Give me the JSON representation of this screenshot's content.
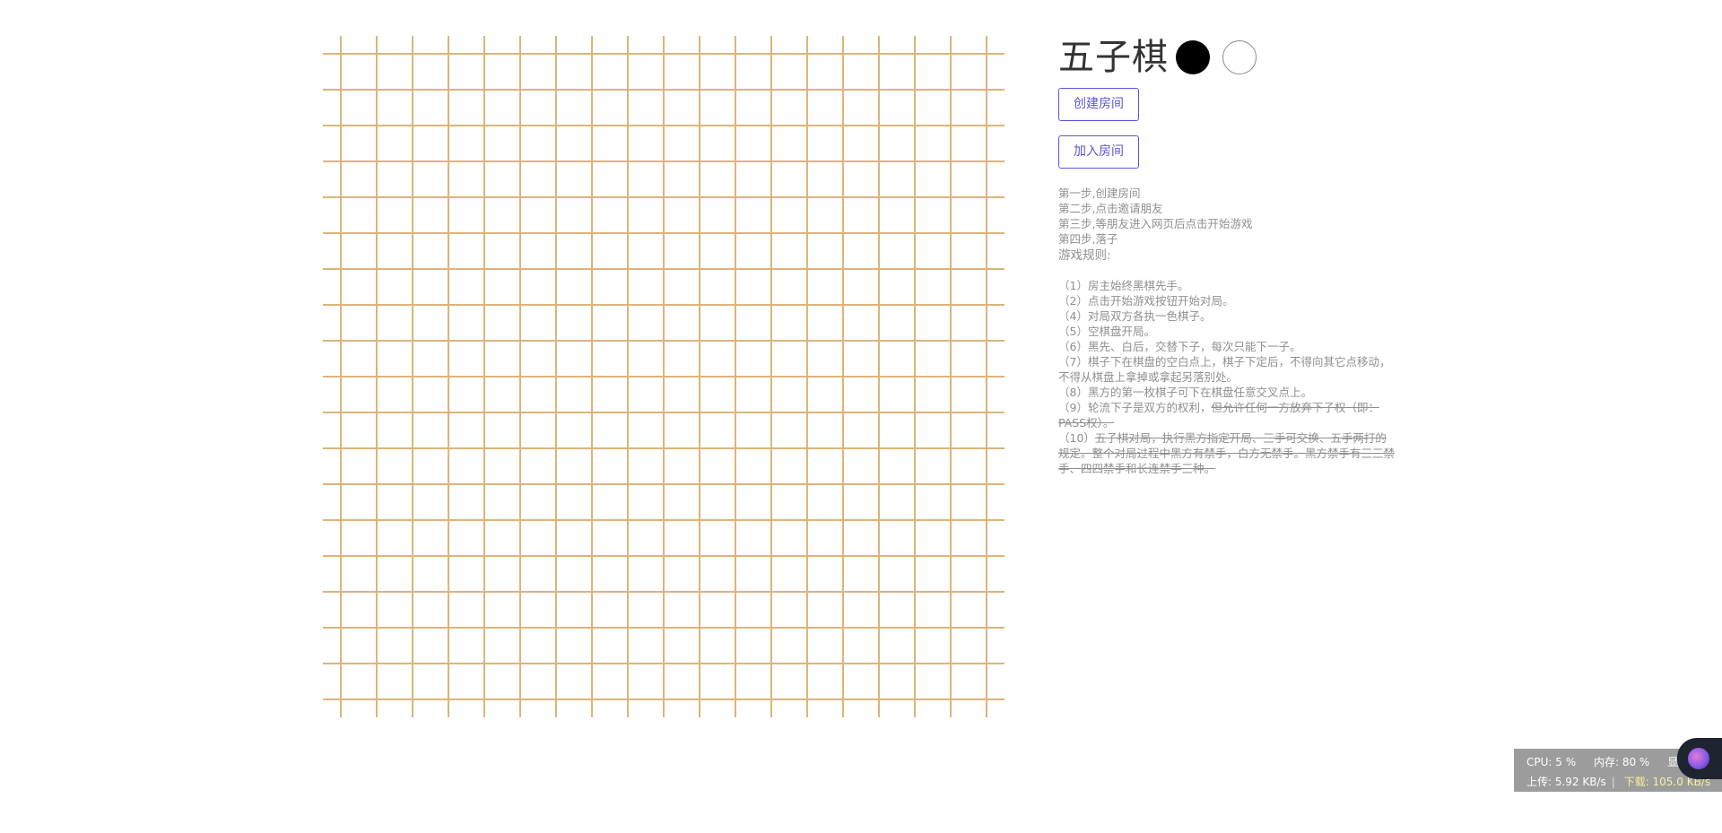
{
  "header": {
    "title": "五子棋"
  },
  "buttons": {
    "create_room": "创建房间",
    "join_room": "加入房间"
  },
  "steps": [
    "第一步,创建房间",
    "第二步,点击邀请朋友",
    "第三步,等朋友进入网页后点击开始游戏",
    "第四步,落子"
  ],
  "rules_title": "游戏规则:",
  "rules": [
    {
      "num": "（1）",
      "text": "房主始终黑棋先手。",
      "struck": ""
    },
    {
      "num": "（2）",
      "text": "点击开始游戏按钮开始对局。",
      "struck": ""
    },
    {
      "num": "（4）",
      "text": "对局双方各执一色棋子。",
      "struck": ""
    },
    {
      "num": "（5）",
      "text": "空棋盘开局。",
      "struck": ""
    },
    {
      "num": "（6）",
      "text": "黑先、白后，交替下子，每次只能下一子。",
      "struck": ""
    },
    {
      "num": "（7）",
      "text": "棋子下在棋盘的空白点上，棋子下定后，不得向其它点移动，不得从棋盘上拿掉或拿起另落别处。",
      "struck": ""
    },
    {
      "num": "（8）",
      "text": "黑方的第一枚棋子可下在棋盘任意交叉点上。",
      "struck": ""
    },
    {
      "num": "（9）",
      "text": "轮流下子是双方的权利，",
      "struck": "但允许任何一方放弃下子权（即：PASS权）。"
    },
    {
      "num": "（10）",
      "text": "",
      "struck": "五子棋对局，执行黑方指定开局、三手可交换、五手两打的规定。整个对局过程中黑方有禁手，白方无禁手。黑方禁手有三三禁手、四四禁手和长连禁手三种。"
    }
  ],
  "status_bar": {
    "cpu": "CPU: 5 %",
    "memory": "内存: 80 %",
    "gpu": "显卡: --%",
    "upload": "上传: 5.92 KB/s",
    "download": "下载: 105.0 KB/s"
  },
  "colors": {
    "board_line": "#dcb47a",
    "button_accent": "#5a56d6",
    "text_muted": "#8f8f8f"
  },
  "board": {
    "grid_lines": 19
  }
}
